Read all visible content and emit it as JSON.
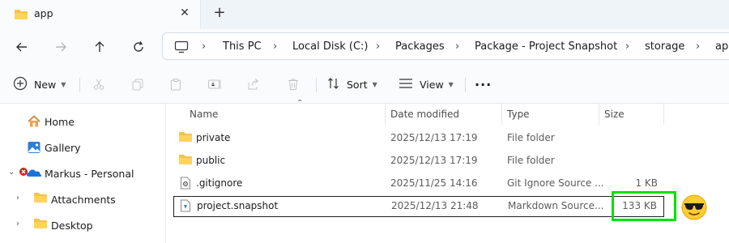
{
  "tab": {
    "title": "app",
    "close_glyph": "✕",
    "add_glyph": "+"
  },
  "address": {
    "crumbs": [
      "This PC",
      "Local Disk (C:)",
      "Packages",
      "Package - Project Snapshot",
      "storage",
      "app"
    ],
    "separator": "›"
  },
  "commands": {
    "new_label": "New",
    "sort_label": "Sort",
    "view_label": "View",
    "more_label": "···"
  },
  "columns": {
    "name": "Name",
    "date": "Date modified",
    "type": "Type",
    "size": "Size"
  },
  "sidebar": {
    "items": [
      {
        "label": "Home",
        "icon": "home-icon"
      },
      {
        "label": "Gallery",
        "icon": "gallery-icon"
      },
      {
        "label": "Markus - Personal",
        "icon": "onedrive-icon"
      },
      {
        "label": "Attachments",
        "icon": "folder-icon"
      },
      {
        "label": "Desktop",
        "icon": "folder-icon"
      }
    ]
  },
  "files": [
    {
      "name": "private",
      "date": "2025/12/13 17:19",
      "type": "File folder",
      "size": "",
      "icon": "folder-icon"
    },
    {
      "name": "public",
      "date": "2025/12/13 17:19",
      "type": "File folder",
      "size": "",
      "icon": "folder-icon"
    },
    {
      "name": ".gitignore",
      "date": "2025/11/25 14:16",
      "type": "Git Ignore Source ...",
      "size": "1 KB",
      "icon": "gear-file-icon"
    },
    {
      "name": "project.snapshot",
      "date": "2025/12/13 21:48",
      "type": "Markdown Source...",
      "size": "133 KB",
      "icon": "file-icon"
    }
  ],
  "colors": {
    "folder": "#f5c24c",
    "highlight": "#00e000",
    "accent": "#0067c0"
  }
}
